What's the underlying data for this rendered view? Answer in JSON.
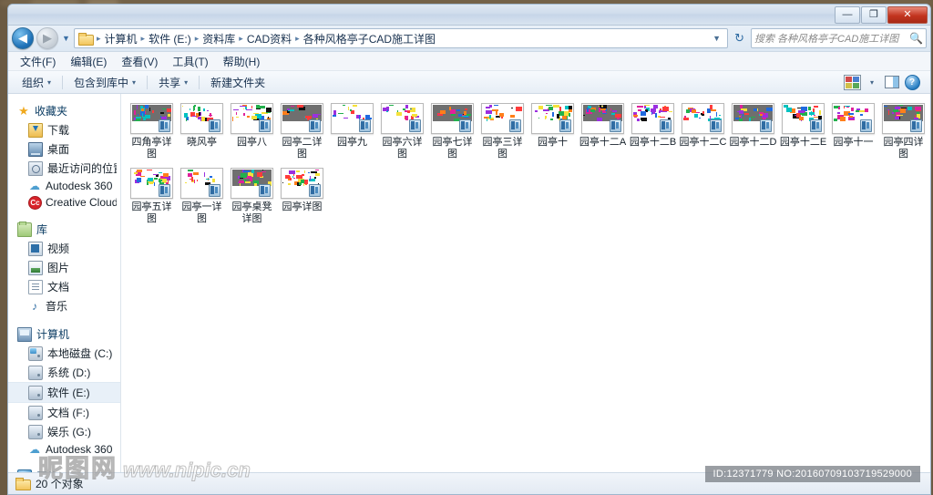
{
  "window": {
    "controls": {
      "minimize": "—",
      "maximize": "❐",
      "close": "✕"
    }
  },
  "address": {
    "back_label": "◀",
    "forward_label": "▶",
    "history_caret": "▼",
    "folder_icon": "folder-icon",
    "crumbs": [
      "计算机",
      "软件 (E:)",
      "资料库",
      "CAD资料",
      "各种风格亭子CAD施工详图"
    ],
    "separator": "▸",
    "dropdown_caret": "▼",
    "refresh_icon": "↻"
  },
  "search": {
    "placeholder": "搜索 各种风格亭子CAD施工详图",
    "icon": "magnifier-icon"
  },
  "menubar": {
    "items": [
      "文件(F)",
      "编辑(E)",
      "查看(V)",
      "工具(T)",
      "帮助(H)"
    ]
  },
  "toolbar": {
    "items": [
      {
        "label": "组织",
        "caret": "▾"
      },
      {
        "label": "包含到库中",
        "caret": "▾"
      },
      {
        "label": "共享",
        "caret": "▾"
      },
      {
        "label": "新建文件夹",
        "caret": ""
      }
    ],
    "right_icons": [
      "views-icon",
      "views-caret-icon",
      "preview-pane-icon",
      "help-icon"
    ],
    "views_caret": "▾",
    "help_glyph": "?"
  },
  "sidebar": {
    "groups": [
      {
        "head": {
          "label": "收藏夹",
          "icon": "star-icon"
        },
        "items": [
          {
            "label": "下载",
            "icon": "downloads-icon"
          },
          {
            "label": "桌面",
            "icon": "desktop-icon"
          },
          {
            "label": "最近访问的位置",
            "icon": "recent-places-icon"
          },
          {
            "label": "Autodesk 360",
            "icon": "cloud-icon"
          },
          {
            "label": "Creative Cloud File",
            "icon": "creative-cloud-icon"
          }
        ]
      },
      {
        "head": {
          "label": "库",
          "icon": "library-icon"
        },
        "items": [
          {
            "label": "视频",
            "icon": "video-icon"
          },
          {
            "label": "图片",
            "icon": "pictures-icon"
          },
          {
            "label": "文档",
            "icon": "documents-icon"
          },
          {
            "label": "音乐",
            "icon": "music-icon"
          }
        ]
      },
      {
        "head": {
          "label": "计算机",
          "icon": "computer-icon"
        },
        "items": [
          {
            "label": "本地磁盘 (C:)",
            "icon": "hard-drive-icon",
            "selected": false
          },
          {
            "label": "系统 (D:)",
            "icon": "drive-icon",
            "selected": false
          },
          {
            "label": "软件 (E:)",
            "icon": "drive-icon",
            "selected": true
          },
          {
            "label": "文档 (F:)",
            "icon": "drive-icon",
            "selected": false
          },
          {
            "label": "娱乐 (G:)",
            "icon": "drive-icon",
            "selected": false
          },
          {
            "label": "Autodesk 360",
            "icon": "cloud-icon",
            "selected": false
          }
        ]
      },
      {
        "head": {
          "label": "网络",
          "icon": "network-icon"
        },
        "items": []
      }
    ]
  },
  "files": [
    {
      "name": "四角亭详图",
      "type": "dwg"
    },
    {
      "name": "晓风亭",
      "type": "dwg"
    },
    {
      "name": "园亭八",
      "type": "dwg"
    },
    {
      "name": "园亭二详图",
      "type": "dwg"
    },
    {
      "name": "园亭九",
      "type": "dwg"
    },
    {
      "name": "园亭六详图",
      "type": "dwg"
    },
    {
      "name": "园亭七详图",
      "type": "dwg"
    },
    {
      "name": "园亭三详图",
      "type": "dwg"
    },
    {
      "name": "园亭十",
      "type": "dwg"
    },
    {
      "name": "园亭十二A",
      "type": "dwg"
    },
    {
      "name": "园亭十二B",
      "type": "dwg"
    },
    {
      "name": "园亭十二C",
      "type": "dwg"
    },
    {
      "name": "园亭十二D",
      "type": "dwg"
    },
    {
      "name": "园亭十二E",
      "type": "dwg"
    },
    {
      "name": "园亭十一",
      "type": "dwg"
    },
    {
      "name": "园亭四详图",
      "type": "dwg"
    },
    {
      "name": "园亭五详图",
      "type": "dwg"
    },
    {
      "name": "园亭一详图",
      "type": "dwg"
    },
    {
      "name": "园亭桌凳详图",
      "type": "dwg"
    },
    {
      "name": "园亭详图",
      "type": "dwg"
    }
  ],
  "statusbar": {
    "count_text": "20 个对象",
    "folder_icon": "folder-icon"
  },
  "watermark": {
    "logo_cn": "昵图网",
    "logo_url": "www.nipic.cn",
    "id_text": "ID:12371779 NO:20160709103719529000"
  },
  "colors": {
    "accent": "#2f6ca3",
    "close_red": "#c3341f",
    "selection": "#e8f0f8",
    "folder_yellow": "#f2c55c"
  }
}
